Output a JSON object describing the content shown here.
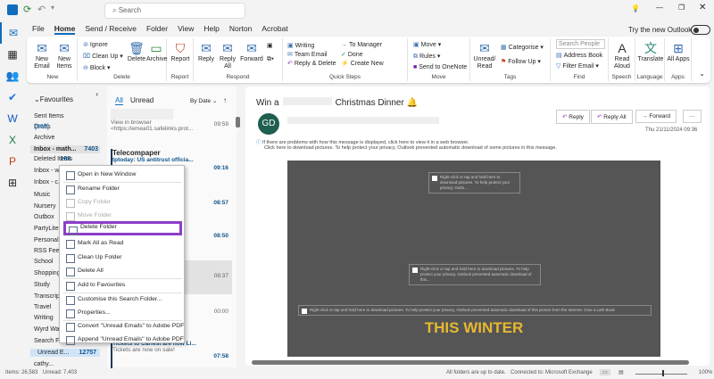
{
  "titlebar": {
    "search_placeholder": "Search",
    "try_new_outlook": "Try the new Outlook"
  },
  "tabs": [
    "File",
    "Home",
    "Send / Receive",
    "Folder",
    "View",
    "Help",
    "Norton",
    "Acrobat"
  ],
  "ribbon": {
    "new": {
      "new_email": "New Email",
      "new_items": "New Items",
      "label": "New"
    },
    "delete": {
      "ignore": "Ignore",
      "clean_up": "Clean Up",
      "block": "Block",
      "delete": "Delete",
      "archive": "Archive",
      "label": "Delete"
    },
    "report": {
      "report": "Report",
      "label": "Report"
    },
    "respond": {
      "reply": "Reply",
      "reply_all": "Reply All",
      "forward": "Forward",
      "label": "Respond"
    },
    "quick_steps": {
      "items": [
        "Writing",
        "Team Email",
        "Reply & Delete",
        "To Manager",
        "Done",
        "Create New"
      ],
      "label": "Quick Steps"
    },
    "move": {
      "move": "Move",
      "rules": "Rules",
      "onenote": "Send to OneNote",
      "label": "Move"
    },
    "tags": {
      "unread_read": "Unread/ Read",
      "categorise": "Categorise",
      "follow_up": "Follow Up",
      "label": "Tags"
    },
    "find": {
      "search_people": "Search People",
      "address_book": "Address Book",
      "filter_email": "Filter Email",
      "label": "Find"
    },
    "speech": {
      "read_aloud": "Read Aloud",
      "label": "Speech"
    },
    "language": {
      "translate": "Translate",
      "label": "Language"
    },
    "apps": {
      "all_apps": "All Apps",
      "label": "Apps"
    }
  },
  "folders": {
    "favourites": "Favourites",
    "items": [
      {
        "name": "Sent Items",
        "count": ""
      },
      {
        "name": "Drafts",
        "count": "[505]"
      },
      {
        "name": "Archive",
        "count": ""
      },
      {
        "name": "Inbox - math...",
        "count": "7403"
      },
      {
        "name": "Deleted Items",
        "count": "168"
      },
      {
        "name": "Inbox - w...",
        "count": ""
      },
      {
        "name": "Inbox - c...",
        "count": ""
      },
      {
        "name": "Music",
        "count": ""
      },
      {
        "name": "Nursery",
        "count": ""
      },
      {
        "name": "Outbox",
        "count": ""
      },
      {
        "name": "PartyLite",
        "count": ""
      },
      {
        "name": "Personal",
        "count": ""
      },
      {
        "name": "RSS Feeds",
        "count": ""
      },
      {
        "name": "School",
        "count": ""
      },
      {
        "name": "Shopping",
        "count": ""
      },
      {
        "name": "Study",
        "count": ""
      },
      {
        "name": "Transcripts",
        "count": ""
      },
      {
        "name": "Travel",
        "count": ""
      },
      {
        "name": "Writing",
        "count": ""
      },
      {
        "name": "Wyrd Wa...",
        "count": ""
      },
      {
        "name": "Search Fo...",
        "count": ""
      },
      {
        "name": "Unread E...",
        "count": "12757"
      },
      {
        "name": "cathy...",
        "count": ""
      }
    ]
  },
  "messages": {
    "tab_all": "All",
    "tab_unread": "Unread",
    "sort": "By Date",
    "items": [
      {
        "sender": "",
        "subject": "View in browser",
        "preview": "<https://emea01.safelinks.prot...",
        "time": "09:59"
      },
      {
        "sender": "Telecompaper",
        "subject": "tptoday: US antitrust officia...",
        "preview": "",
        "time": "09:16"
      },
      {
        "sender": "",
        "subject": "",
        "preview": "",
        "time": "08:57"
      },
      {
        "sender": "",
        "subject": "",
        "preview": "",
        "time": "08:50"
      },
      {
        "sender": "",
        "subject": "",
        "preview": "",
        "time": "08:37"
      },
      {
        "sender": "",
        "subject": "",
        "preview": "",
        "time": "00:00"
      },
      {
        "sender": "",
        "subject": "Tickets to Carfest are now Li...",
        "preview": "Tickets are now on sale!",
        "time": "07:58"
      }
    ]
  },
  "context_menu": [
    "Open in New Window",
    "Rename Folder",
    "Copy Folder",
    "Move Folder",
    "Delete Folder",
    "Mark All as Read",
    "Clean Up Folder",
    "Delete All",
    "Add to Favourites",
    "Customise this Search Folder...",
    "Properties...",
    "Convert \"Unread Emails\" to Adobe PDF",
    "Append \"Unread Emails\" to Adobe PDF"
  ],
  "reading": {
    "subject_start": "Win a",
    "subject_end": "Christmas Dinner",
    "avatar": "GD",
    "reply": "Reply",
    "reply_all": "Reply All",
    "forward": "Forward",
    "more": "···",
    "date": "Thu 21/11/2024 09:36",
    "info1": "If there are problems with how this message is displayed, click here to view it in a web browser.",
    "info2": "Click here to download pictures. To help protect your privacy, Outlook prevented automatic download of some pictures in this message.",
    "ph1": "Right-click or tap and hold here to download pictures. To help protect your privacy, Outlo...",
    "ph2": "Right-click or tap and hold here to download pictures. To help protect your privacy, Outlook prevented automatic download of this...",
    "ph3": "Right-click or tap and hold here to download pictures. To help protect your privacy, Outlook prevented automatic download of this picture from the Internet. Give a Lath Book",
    "headline": "THIS WINTER"
  },
  "status": {
    "items": "Items: 26,583",
    "unread": "Unread: 7,403",
    "sync": "All folders are up to date.",
    "connection": "Connected to: Microsoft Exchange",
    "zoom": "100%"
  }
}
